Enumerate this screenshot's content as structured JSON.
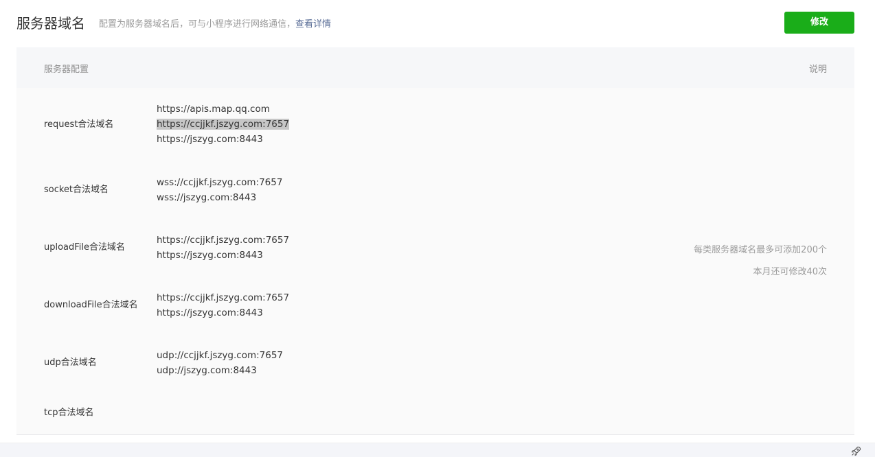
{
  "header": {
    "title": "服务器域名",
    "description": "配置为服务器域名后，可与小程序进行网络通信，",
    "link_text": "查看详情",
    "edit_label": "修改"
  },
  "table": {
    "col_config": "服务器配置",
    "col_desc": "说明",
    "rows": [
      {
        "label": "request合法域名",
        "values": [
          "https://apis.map.qq.com",
          "https://ccjjkf.jszyg.com:7657",
          "https://jszyg.com:8443"
        ]
      },
      {
        "label": "socket合法域名",
        "values": [
          "wss://ccjjkf.jszyg.com:7657",
          "wss://jszyg.com:8443"
        ]
      },
      {
        "label": "uploadFile合法域名",
        "values": [
          "https://ccjjkf.jszyg.com:7657",
          "https://jszyg.com:8443"
        ]
      },
      {
        "label": "downloadFile合法域名",
        "values": [
          "https://ccjjkf.jszyg.com:7657",
          "https://jszyg.com:8443"
        ]
      },
      {
        "label": "udp合法域名",
        "values": [
          "udp://ccjjkf.jszyg.com:7657",
          "udp://jszyg.com:8443"
        ]
      },
      {
        "label": "tcp合法域名",
        "values": []
      }
    ],
    "notes": [
      "每类服务器域名最多可添加200个",
      "本月还可修改40次"
    ]
  },
  "footer": {
    "icon": "rocket-icon"
  },
  "colors": {
    "accent_green": "#1aad19",
    "link_blue": "#576b95"
  }
}
